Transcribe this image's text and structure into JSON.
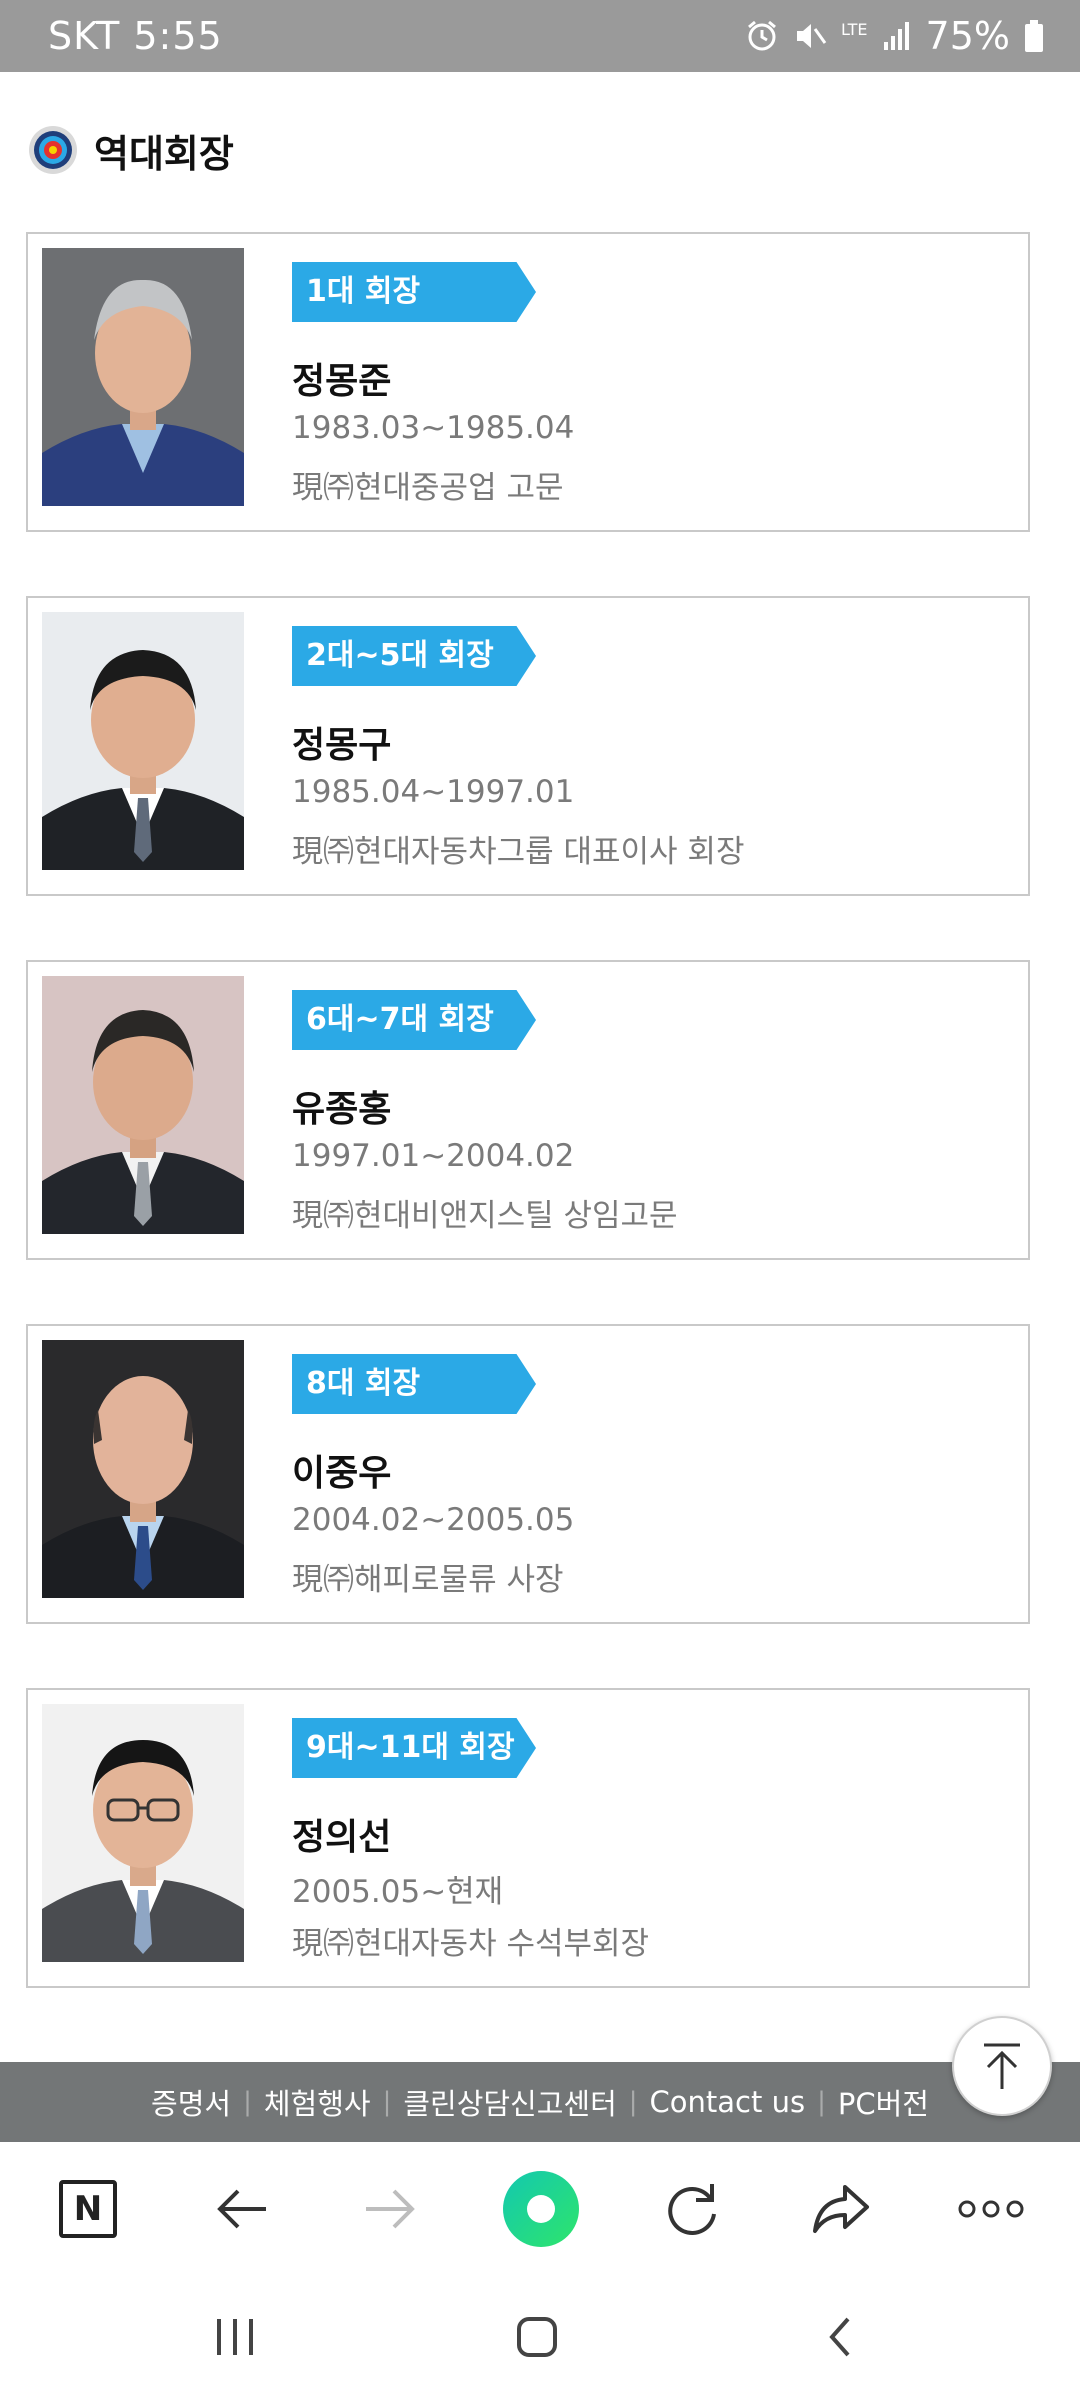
{
  "status_bar": {
    "carrier_time": "SKT 5:55",
    "lte_label": "LTE",
    "battery": "75%"
  },
  "page": {
    "title": "역대회장"
  },
  "presidents": [
    {
      "badge": "1대 회장",
      "name": "정몽준",
      "term": "1983.03~1985.04",
      "position": "現㈜현대중공업 고문"
    },
    {
      "badge": "2대~5대 회장",
      "name": "정몽구",
      "term": "1985.04~1997.01",
      "position": "現㈜현대자동차그룹 대표이사 회장"
    },
    {
      "badge": "6대~7대 회장",
      "name": "유종홍",
      "term": "1997.01~2004.02",
      "position": "現㈜현대비앤지스틸 상임고문"
    },
    {
      "badge": "8대 회장",
      "name": "이중우",
      "term": "2004.02~2005.05",
      "position": "現㈜해피로물류 사장"
    },
    {
      "badge": "9대~11대 회장",
      "name": "정의선",
      "term": "2005.05~현재",
      "position": "現㈜현대자동차 수석부회장"
    }
  ],
  "footer": {
    "links": [
      "증명서",
      "체험행사",
      "클린상담신고센터",
      "Contact us",
      "PC버전"
    ]
  },
  "toolbar": {
    "naver_letter": "N"
  },
  "colors": {
    "badge": "#2ba9e6",
    "footer_bg": "#737677",
    "status_bar_bg": "#9a9a9a",
    "green_button": "#1ed88a"
  },
  "icons": [
    "target-icon",
    "alarm-icon",
    "mute-icon",
    "signal-icon",
    "battery-icon",
    "arrow-up-icon",
    "back-arrow-icon",
    "forward-arrow-icon",
    "reload-icon",
    "share-icon",
    "more-icon",
    "recents-icon",
    "home-icon",
    "nav-back-icon"
  ]
}
